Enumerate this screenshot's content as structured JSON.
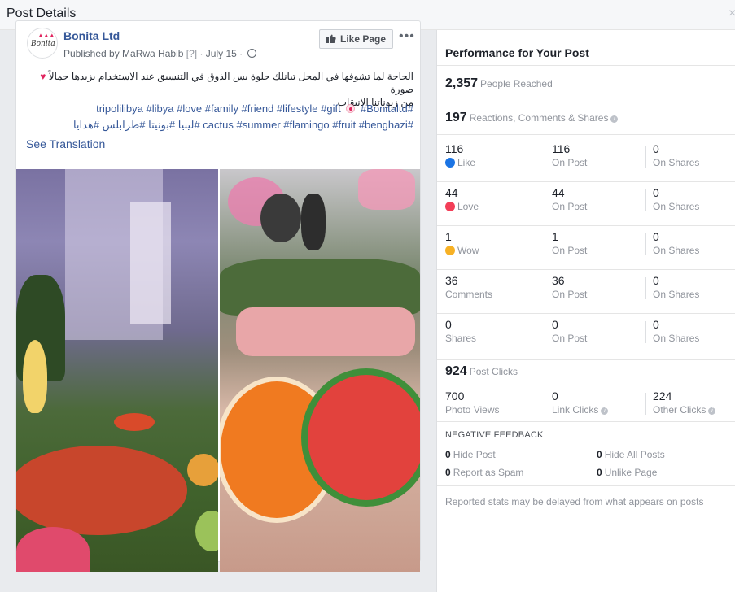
{
  "dialog": {
    "title": "Post Details",
    "close_glyph": "×"
  },
  "post": {
    "page_name": "Bonita Ltd",
    "avatar_text": "Bonita",
    "published_by": "Published by MaRwa Habib",
    "help_marker": "[?]",
    "date": "July 15",
    "like_page_label": "Like Page",
    "more_glyph": "•••",
    "text_line1": "الحاجة لما تشوفها في المحل تبانلك حلوة بس الذوق في التنسيق عند الاستخدام يزيدها جمالاً",
    "text_line1_end": "صورة",
    "text_line2": "من زبوناتنا الانيقات",
    "hashtags_line1": "#tripolilibya #libya #love #family #friend #lifestyle #gift",
    "hashtags_line1_end": "#Bonitaltd",
    "hashtags_line2": "#cactus #summer #flamingo #fruit #benghazi #ليبيا #بونيتا #طرابلس #هدايا",
    "see_translation": "See Translation"
  },
  "performance": {
    "title": "Performance for Your Post",
    "reached": {
      "value": "2,357",
      "label": "People Reached"
    },
    "engagement": {
      "value": "197",
      "label": "Reactions, Comments & Shares"
    },
    "rows": [
      {
        "total": "116",
        "label": "Like",
        "icon": "like-icon",
        "on_post": "116",
        "on_post_label": "On Post",
        "on_shares": "0",
        "on_shares_label": "On Shares"
      },
      {
        "total": "44",
        "label": "Love",
        "icon": "love-icon",
        "on_post": "44",
        "on_post_label": "On Post",
        "on_shares": "0",
        "on_shares_label": "On Shares"
      },
      {
        "total": "1",
        "label": "Wow",
        "icon": "wow-icon",
        "on_post": "1",
        "on_post_label": "On Post",
        "on_shares": "0",
        "on_shares_label": "On Shares"
      },
      {
        "total": "36",
        "label": "Comments",
        "icon": "",
        "on_post": "36",
        "on_post_label": "On Post",
        "on_shares": "0",
        "on_shares_label": "On Shares"
      },
      {
        "total": "0",
        "label": "Shares",
        "icon": "",
        "on_post": "0",
        "on_post_label": "On Post",
        "on_shares": "0",
        "on_shares_label": "On Shares"
      }
    ],
    "clicks": {
      "value": "924",
      "label": "Post Clicks",
      "photo_views": "700",
      "photo_views_label": "Photo Views",
      "link_clicks": "0",
      "link_clicks_label": "Link Clicks",
      "other_clicks": "224",
      "other_clicks_label": "Other Clicks"
    },
    "negative": {
      "title": "NEGATIVE FEEDBACK",
      "hide_post": "0",
      "hide_post_label": "Hide Post",
      "hide_all": "0",
      "hide_all_label": "Hide All Posts",
      "spam": "0",
      "spam_label": "Report as Spam",
      "unlike": "0",
      "unlike_label": "Unlike Page"
    },
    "footnote": "Reported stats may be delayed from what appears on posts"
  },
  "colors": {
    "link_blue": "#365899",
    "like_blue": "#1b74e4",
    "love_red": "#f33e58",
    "wow_yellow": "#f7b125"
  }
}
